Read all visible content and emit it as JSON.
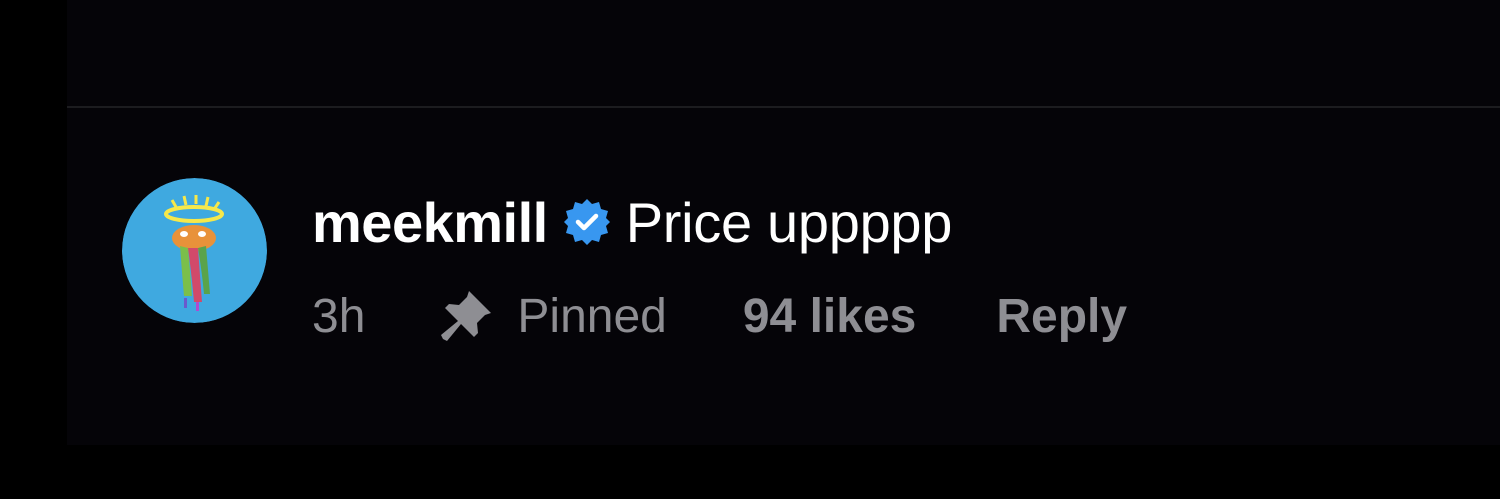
{
  "comment": {
    "username": "meekmill",
    "verified": true,
    "text": "Price uppppp",
    "timestamp": "3h",
    "pinned_label": "Pinned",
    "likes_label": "94 likes",
    "reply_label": "Reply",
    "avatar_icon": "avatar-image",
    "verified_icon": "verified-badge-icon",
    "pin_icon": "pushpin-icon"
  },
  "colors": {
    "background": "#000000",
    "primary_text": "#ffffff",
    "secondary_text": "#8e8e93",
    "verified_badge": "#3897f0",
    "avatar_background": "#3fa9e0"
  }
}
